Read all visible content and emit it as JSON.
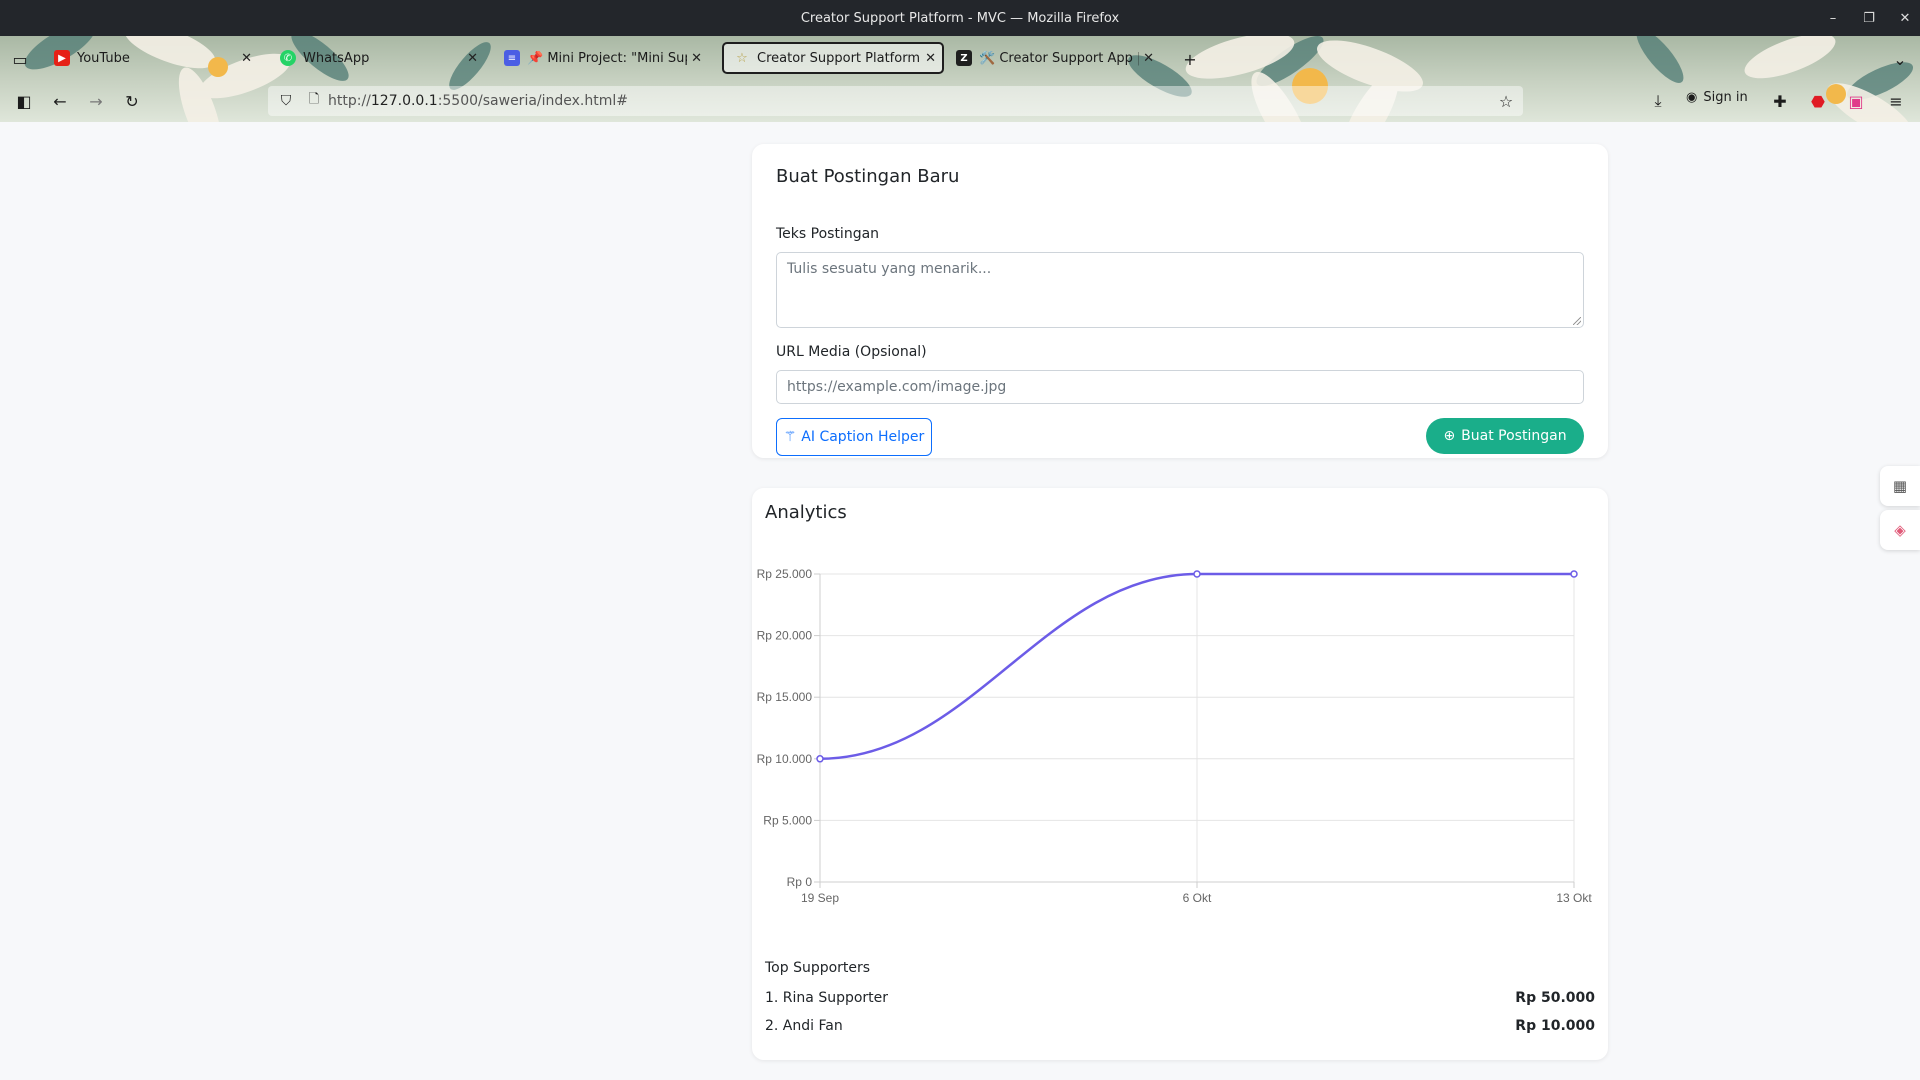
{
  "window": {
    "title": "Creator Support Platform - MVC — Mozilla Firefox"
  },
  "tabs": [
    {
      "title": "YouTube",
      "icon": "youtube-icon"
    },
    {
      "title": "WhatsApp",
      "icon": "whatsapp-icon"
    },
    {
      "title": "📌 Mini Project: \"Mini Suppo",
      "icon": "document-icon"
    },
    {
      "title": "Creator Support Platform - M",
      "icon": "star-icon",
      "active": true
    },
    {
      "title": "🛠️ Creator Support App | Z",
      "icon": "z-icon"
    }
  ],
  "nav": {
    "url_prefix": "http://",
    "url_host": "127.0.0.1",
    "url_rest": ":5500/saweria/index.html#",
    "signin": "Sign in"
  },
  "post_form": {
    "title": "Buat Postingan Baru",
    "text_label": "Teks Postingan",
    "text_placeholder": "Tulis sesuatu yang menarik...",
    "media_label": "URL Media (Opsional)",
    "media_placeholder": "https://example.com/image.jpg",
    "ai_button": "AI Caption Helper",
    "submit_button": "Buat Postingan"
  },
  "analytics": {
    "title": "Analytics",
    "supporters_title": "Top Supporters",
    "supporters": [
      {
        "name": "1. Rina Supporter",
        "amount": "Rp 50.000"
      },
      {
        "name": "2. Andi Fan",
        "amount": "Rp 10.000"
      }
    ]
  },
  "chart_data": {
    "type": "line",
    "categories": [
      "19 Sep",
      "6 Okt",
      "13 Okt"
    ],
    "values": [
      10000,
      25000,
      25000
    ],
    "ylim": [
      0,
      25000
    ],
    "yticks": [
      0,
      5000,
      10000,
      15000,
      20000,
      25000
    ],
    "ytick_labels": [
      "Rp 0",
      "Rp 5.000",
      "Rp 10.000",
      "Rp 15.000",
      "Rp 20.000",
      "Rp 25.000"
    ],
    "line_color": "#6c5ce7",
    "grid": true
  },
  "colors": {
    "accent": "#0d6efd",
    "success": "#1aae8a"
  }
}
